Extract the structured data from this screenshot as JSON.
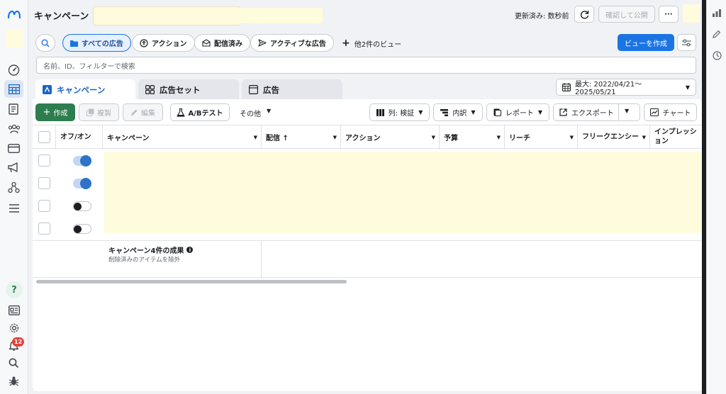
{
  "header": {
    "title": "キャンペーン",
    "updated": "更新済み: 数秒前",
    "publish_label": "確認して公開",
    "more_label": "···"
  },
  "views": {
    "items": [
      {
        "label": "すべての広告",
        "icon": "folder-icon",
        "active": true
      },
      {
        "label": "アクション",
        "icon": "action-icon",
        "active": false
      },
      {
        "label": "配信済み",
        "icon": "mail-icon",
        "active": false
      },
      {
        "label": "アクティブな広告",
        "icon": "send-icon",
        "active": false
      }
    ],
    "more_views": "他2件のビュー",
    "create_view": "ビューを作成"
  },
  "search": {
    "placeholder": "名前、ID、フィルターで検索"
  },
  "tabs": [
    {
      "label": "キャンペーン",
      "active": true
    },
    {
      "label": "広告セット",
      "active": false
    },
    {
      "label": "広告",
      "active": false
    }
  ],
  "date_range": "最大: 2022/04/21～2025/05/21",
  "toolbar": {
    "create": "作成",
    "duplicate": "複製",
    "edit": "編集",
    "ab_test": "A/Bテスト",
    "other": "その他",
    "columns": "列: 検証",
    "breakdown": "内訳",
    "report": "レポート",
    "export": "エクスポート",
    "chart": "チャート"
  },
  "table": {
    "columns": [
      {
        "label": "オフ/オン"
      },
      {
        "label": "キャンペーン"
      },
      {
        "label": "配信 ↑"
      },
      {
        "label": "アクション"
      },
      {
        "label": "予算"
      },
      {
        "label": "リーチ"
      },
      {
        "label": "フリークエンシー"
      },
      {
        "label": "インプレッション"
      }
    ],
    "rows": [
      {
        "on": true
      },
      {
        "on": true
      },
      {
        "on": false
      },
      {
        "on": false
      }
    ],
    "summary_title": "キャンペーン4件の成果",
    "summary_sub": "削除済みのアイテムを除外"
  },
  "notifications": {
    "count": "12"
  },
  "colors": {
    "accent": "#1b74e4",
    "create": "#2e7d4f",
    "badge": "#e0443b",
    "redacted": "#fffbdd"
  }
}
